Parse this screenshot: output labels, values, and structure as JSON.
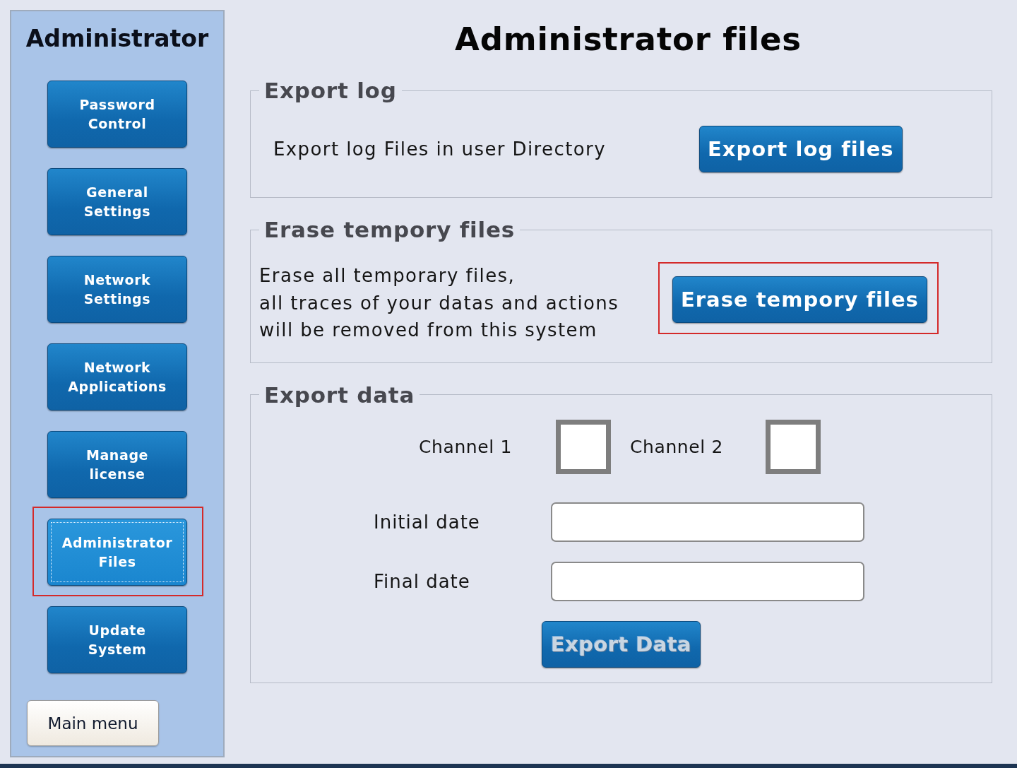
{
  "sidebar": {
    "title": "Administrator",
    "items": [
      {
        "label": "Password\nControl",
        "selected": false,
        "highlighted": false
      },
      {
        "label": "General\nSettings",
        "selected": false,
        "highlighted": false
      },
      {
        "label": "Network\nSettings",
        "selected": false,
        "highlighted": false
      },
      {
        "label": "Network\nApplications",
        "selected": false,
        "highlighted": false
      },
      {
        "label": "Manage\nlicense",
        "selected": false,
        "highlighted": false
      },
      {
        "label": "Administrator\nFiles",
        "selected": true,
        "highlighted": true
      },
      {
        "label": "Update\nSystem",
        "selected": false,
        "highlighted": false
      }
    ],
    "main_menu": "Main menu"
  },
  "page": {
    "title": "Administrator files"
  },
  "sections": [
    {
      "kind": "action",
      "title": "Export log",
      "description": "Export log Files in user Directory",
      "button": {
        "label": "Export log files",
        "highlighted": false
      }
    },
    {
      "kind": "action",
      "title": "Erase tempory files",
      "description": "Erase all temporary files,\nall traces of your datas and actions\nwill be removed from this system",
      "button": {
        "label": "Erase tempory files",
        "highlighted": true
      }
    },
    {
      "kind": "export",
      "title": "Export data",
      "channels": [
        {
          "label": "Channel 1",
          "checked": false
        },
        {
          "label": "Channel 2",
          "checked": false
        }
      ],
      "fields": [
        {
          "label": "Initial date"
        },
        {
          "label": "Final date"
        }
      ],
      "button": {
        "label": "Export Data",
        "disabled": true
      }
    }
  ]
}
